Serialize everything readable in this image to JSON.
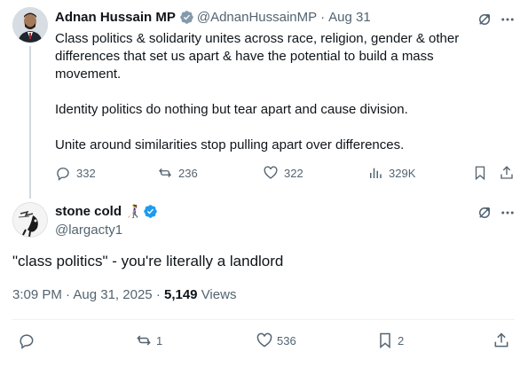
{
  "parent_tweet": {
    "display_name": "Adnan Hussain MP",
    "handle": "@AdnanHussainMP",
    "separator": "·",
    "date": "Aug 31",
    "paragraphs": [
      "Class politics & solidarity unites across race, religion, gender & other differences that set us apart & have the potential to build a mass movement.",
      "Identity politics do nothing but tear apart and cause division.",
      "Unite around similarities stop pulling apart over differences."
    ],
    "replies": "332",
    "reposts": "236",
    "likes": "322",
    "views": "329K",
    "verified_color": "#829aab"
  },
  "main_tweet": {
    "display_name": "stone cold",
    "name_emoji": "👩‍🦯",
    "handle": "@largacty1",
    "text": "\"class politics\" - you're literally a landlord",
    "time": "3:09 PM",
    "separator": "·",
    "date": "Aug 31, 2025",
    "separator2": "·",
    "views_count": "5,149",
    "views_label": "Views",
    "reposts": "1",
    "likes": "536",
    "bookmarks": "2",
    "verified_color": "#1d9bf0"
  },
  "icons": {
    "grok": "grok-icon",
    "more": "more-icon",
    "reply": "reply-icon",
    "repost": "repost-icon",
    "like": "like-icon",
    "views": "views-icon",
    "bookmark": "bookmark-icon",
    "share": "share-icon"
  },
  "colors": {
    "text_primary": "#0f1419",
    "text_secondary": "#536471",
    "divider": "#eff3f4",
    "thread_line": "#cfd9de"
  }
}
